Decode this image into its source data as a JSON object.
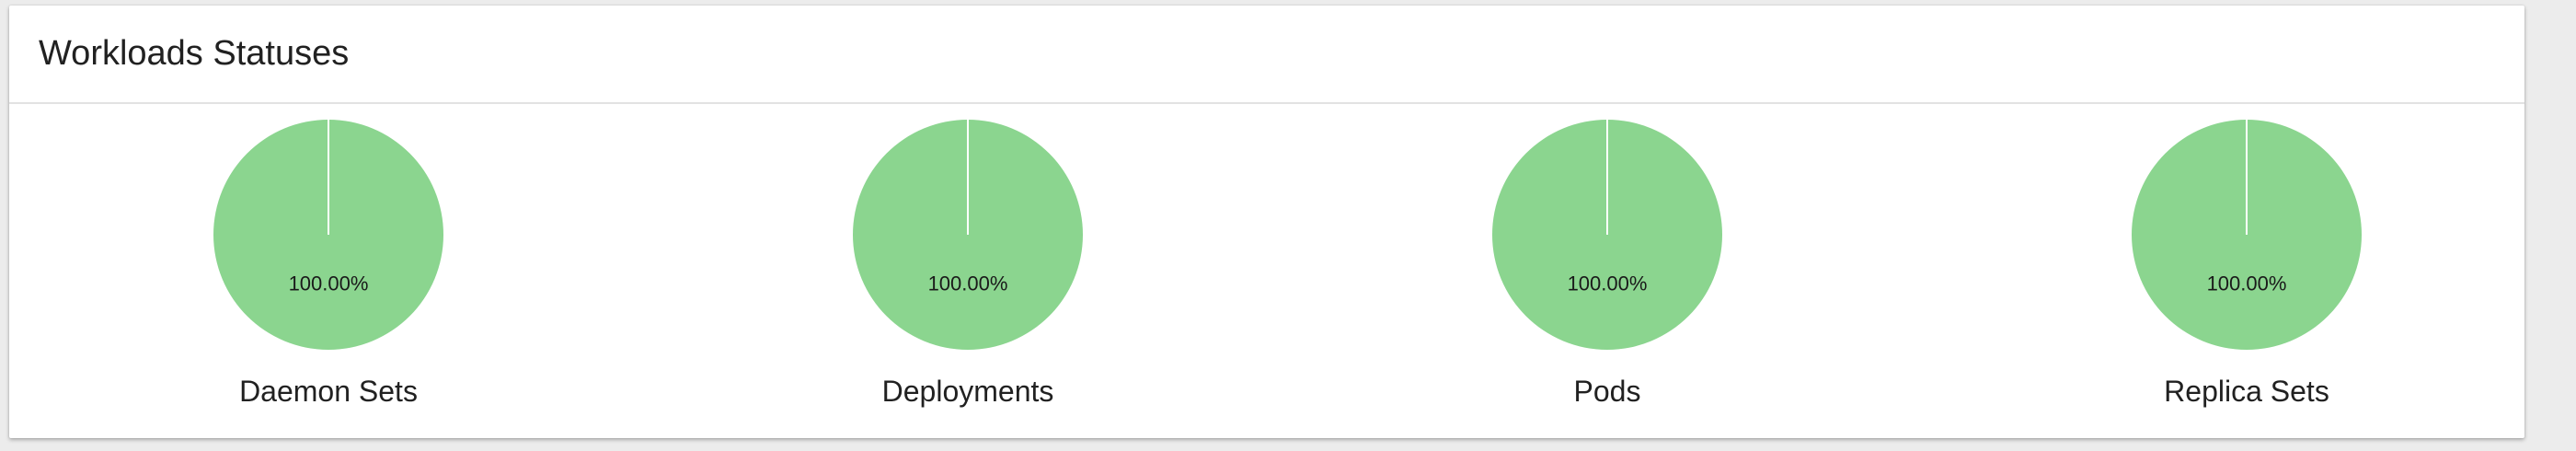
{
  "card": {
    "title": "Workloads Statuses"
  },
  "colors": {
    "slice": "#8bd58f",
    "divider": "#ffffff"
  },
  "chart_data": [
    {
      "type": "pie",
      "label": "Daemon Sets",
      "slices": [
        {
          "value": 100.0,
          "label": "100.00%"
        }
      ]
    },
    {
      "type": "pie",
      "label": "Deployments",
      "slices": [
        {
          "value": 100.0,
          "label": "100.00%"
        }
      ]
    },
    {
      "type": "pie",
      "label": "Pods",
      "slices": [
        {
          "value": 100.0,
          "label": "100.00%"
        }
      ]
    },
    {
      "type": "pie",
      "label": "Replica Sets",
      "slices": [
        {
          "value": 100.0,
          "label": "100.00%"
        }
      ]
    }
  ]
}
